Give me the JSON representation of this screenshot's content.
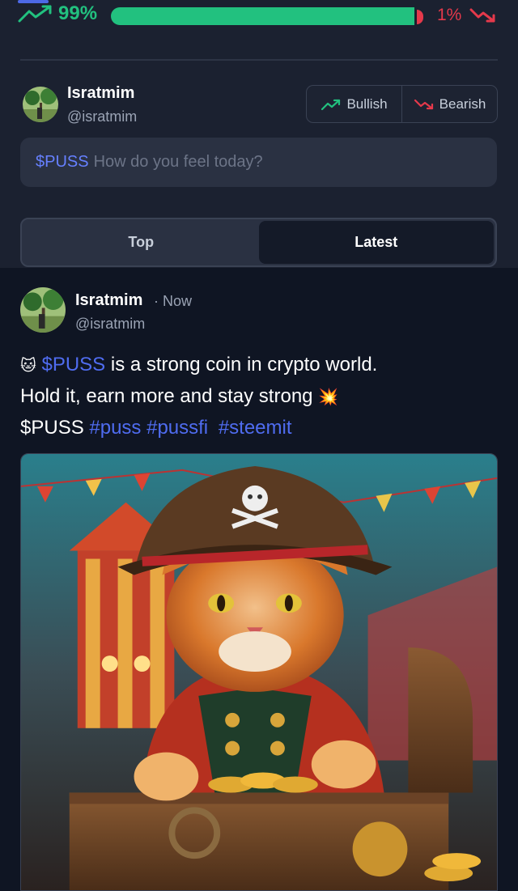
{
  "sentiment": {
    "bullish_percent": "99%",
    "bearish_percent": "1%",
    "bullish_fraction": 0.99,
    "colors": {
      "bullish": "#22c17f",
      "bearish": "#e5394b"
    }
  },
  "composer": {
    "user_name": "Isratmim",
    "user_handle": "@isratmim",
    "bullish_label": "Bullish",
    "bearish_label": "Bearish",
    "ticker": "$PUSS",
    "placeholder": "How do you feel today?"
  },
  "tabs": [
    {
      "label": "Top",
      "active": false
    },
    {
      "label": "Latest",
      "active": true
    }
  ],
  "post": {
    "author_name": "Isratmim",
    "time": "· Now",
    "author_handle": "@isratmim",
    "line1_emoji": "🐱",
    "line1_ticker": "$PUSS",
    "line1_text": " is a strong coin in crypto world.",
    "line2_text": "Hold it, earn more and stay strong ",
    "line2_emoji": "💥",
    "line3_ticker": "$PUSS",
    "hashtags": [
      "#puss",
      "#pussfi",
      "#steemit"
    ],
    "image_icon": "pirate-cat-image"
  },
  "accent_color": "#4f6cf0"
}
